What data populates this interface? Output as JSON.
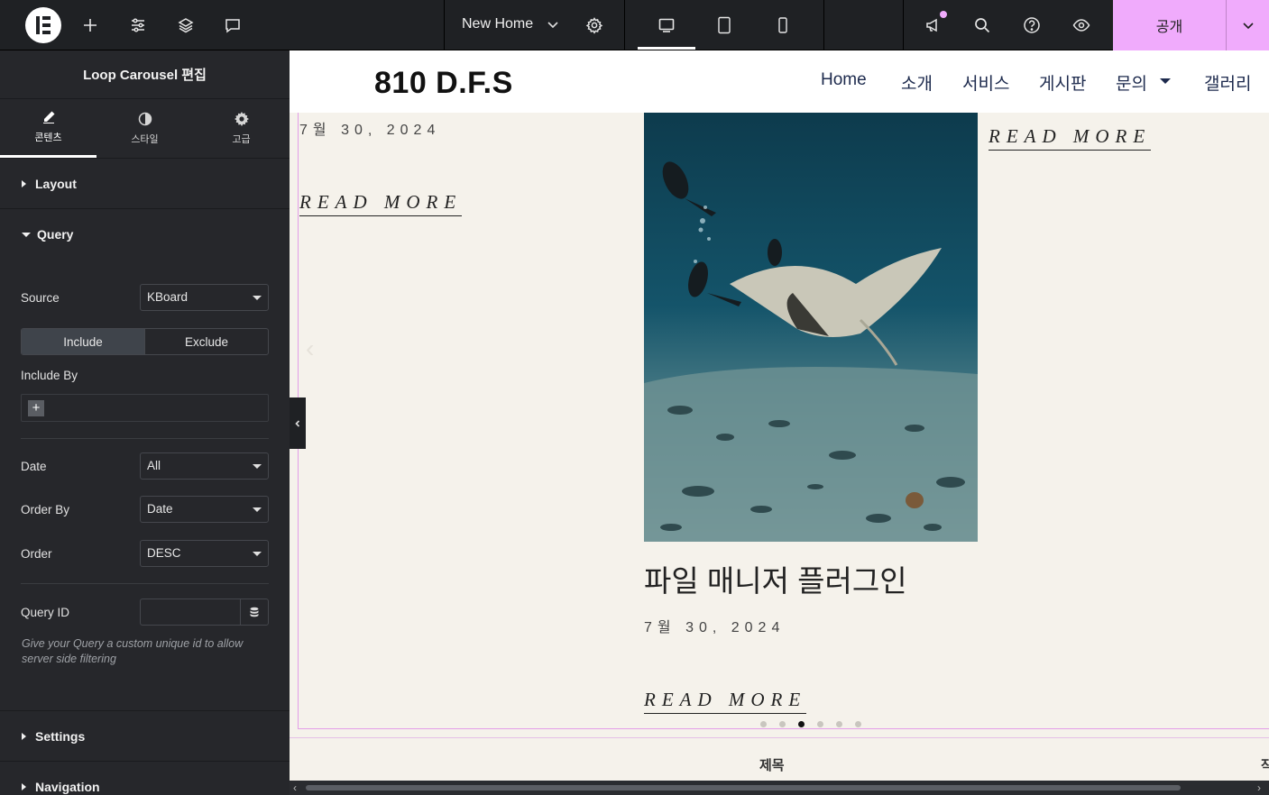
{
  "topbar": {
    "page_title": "New Home",
    "publish_label": "공개"
  },
  "panel": {
    "title": "Loop Carousel 편집",
    "tabs": [
      {
        "label": "콘텐츠",
        "icon": "pencil-icon",
        "active": true
      },
      {
        "label": "스타일",
        "icon": "half-circle-icon",
        "active": false
      },
      {
        "label": "고급",
        "icon": "gear-icon",
        "active": false
      }
    ],
    "sections": {
      "layout": "Layout",
      "query": "Query",
      "settings": "Settings",
      "navigation": "Navigation"
    },
    "query": {
      "source_label": "Source",
      "source_value": "KBoard",
      "include_label": "Include",
      "exclude_label": "Exclude",
      "include_by_label": "Include By",
      "add_symbol": "+",
      "date_label": "Date",
      "date_value": "All",
      "orderby_label": "Order By",
      "orderby_value": "Date",
      "order_label": "Order",
      "order_value": "DESC",
      "queryid_label": "Query ID",
      "queryid_value": "",
      "help_text": "Give your Query a custom unique id to allow server side filtering"
    }
  },
  "canvas": {
    "site_logo": "810 D.F.S",
    "nav": [
      "Home",
      "소개",
      "서비스",
      "게시판",
      "문의",
      "갤러리"
    ],
    "posts": [
      {
        "date": "7월 30, 2024",
        "readmore": "READ MORE"
      },
      {
        "title": "파일 매니저 플러그인",
        "date": "7월 30, 2024",
        "readmore": "READ MORE"
      },
      {
        "readmore": "READ MORE"
      }
    ],
    "carousel": {
      "total_slides": 6,
      "active_index": 2
    },
    "table_header_title": "제목",
    "table_header_partial": "작"
  },
  "colors": {
    "accent": "#f0abfc",
    "panel_bg": "#26272b",
    "canvas_bg": "#f5f2eb"
  }
}
